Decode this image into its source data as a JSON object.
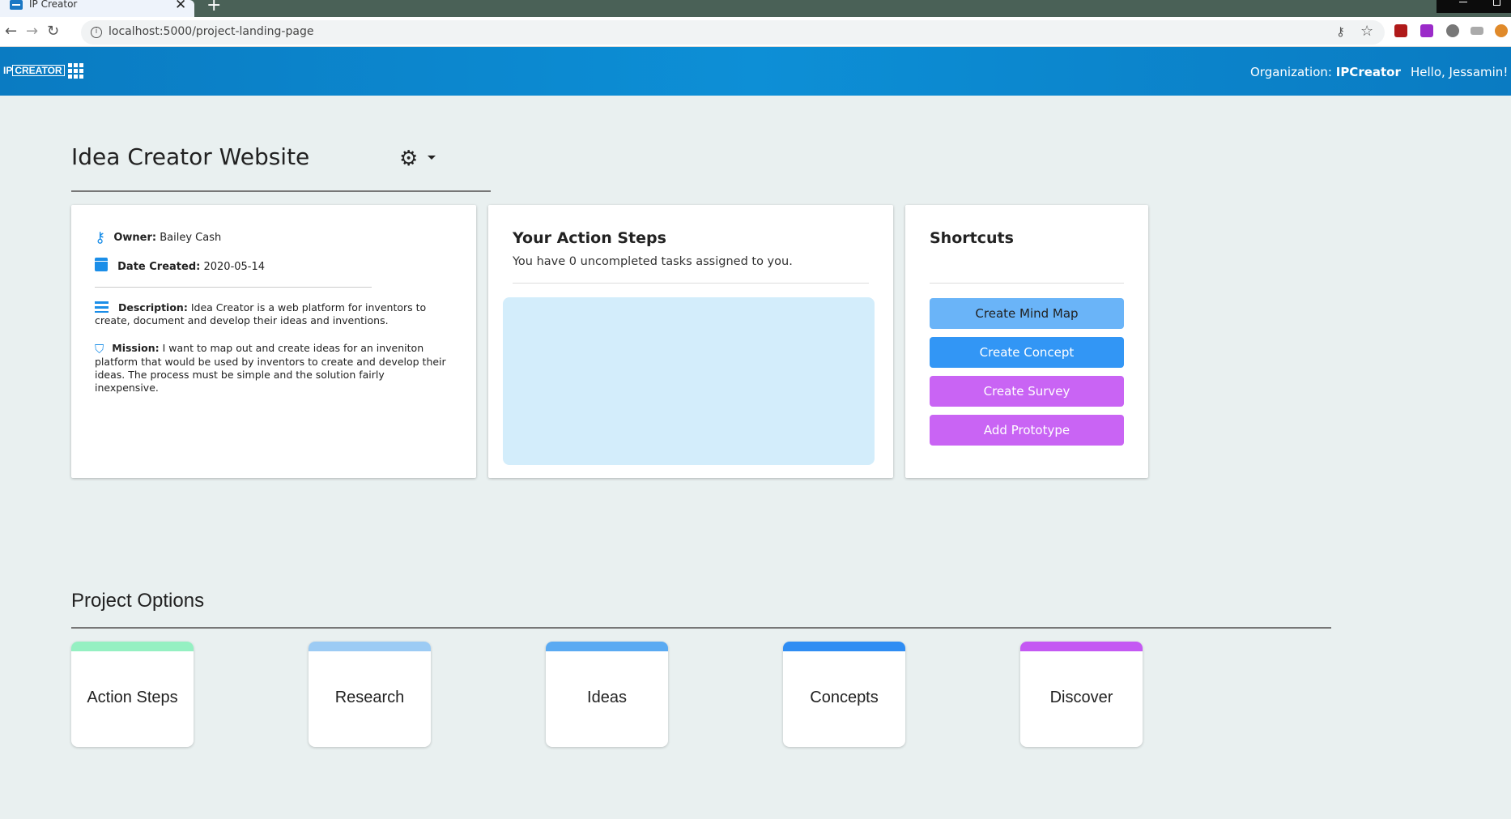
{
  "browser": {
    "tab_title": "IP Creator",
    "tab_close": "✕",
    "new_tab": "+",
    "url": "localhost:5000/project-landing-page"
  },
  "header": {
    "logo_ip": "IP",
    "logo_creator": "CREATOR",
    "org_label": "Organization:",
    "org_name": "IPCreator",
    "greeting": "Hello, Jessamin!"
  },
  "project": {
    "title": "Idea Creator Website",
    "owner_label": "Owner:",
    "owner": "Bailey Cash",
    "date_label": "Date Created:",
    "date": "2020-05-14",
    "description_label": "Description:",
    "description": "Idea Creator is a web platform for inventors to create, document and develop their ideas and inventions.",
    "mission_label": "Mission:",
    "mission": "I want to map out and create ideas for an inveniton platform that would be used by inventors to create and develop their ideas. The process must be simple and the solution fairly inexpensive."
  },
  "action_steps": {
    "heading": "Your Action Steps",
    "subtitle": "You have 0 uncompleted tasks assigned to you."
  },
  "shortcuts": {
    "heading": "Shortcuts",
    "buttons": [
      {
        "label": "Create Mind Map",
        "color": "#6ab4f8",
        "text_color": "#222222"
      },
      {
        "label": "Create Concept",
        "color": "#3296f5",
        "text_color": "#ffffff"
      },
      {
        "label": "Create Survey",
        "color": "#c964f4",
        "text_color": "#ffffff"
      },
      {
        "label": "Add Prototype",
        "color": "#c964f4",
        "text_color": "#ffffff"
      }
    ]
  },
  "project_options": {
    "heading": "Project Options",
    "items": [
      {
        "label": "Action Steps",
        "color": "#95f0c2"
      },
      {
        "label": "Research",
        "color": "#9ccbf4"
      },
      {
        "label": "Ideas",
        "color": "#5aaaf2"
      },
      {
        "label": "Concepts",
        "color": "#2f8df3"
      },
      {
        "label": "Discover",
        "color": "#c459f3"
      }
    ]
  },
  "colors": {
    "header_blue": "#0a7bc2",
    "icon_blue": "#1b8ee8",
    "page_bg": "#e9f0f0"
  }
}
